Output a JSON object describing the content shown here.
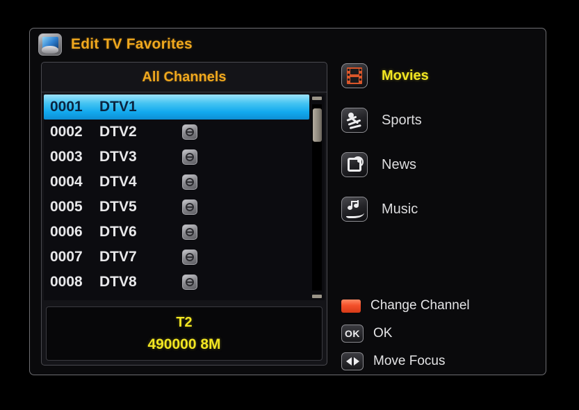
{
  "window": {
    "title": "Edit TV Favorites",
    "title_icon": "tv-icon"
  },
  "channel_list": {
    "header": "All Channels",
    "columns": [
      "number",
      "name",
      "lock"
    ],
    "rows": [
      {
        "number": "0001",
        "name": "DTV1",
        "locked": false,
        "selected": true
      },
      {
        "number": "0002",
        "name": "DTV2",
        "locked": true,
        "selected": false
      },
      {
        "number": "0003",
        "name": "DTV3",
        "locked": true,
        "selected": false
      },
      {
        "number": "0004",
        "name": "DTV4",
        "locked": true,
        "selected": false
      },
      {
        "number": "0005",
        "name": "DTV5",
        "locked": true,
        "selected": false
      },
      {
        "number": "0006",
        "name": "DTV6",
        "locked": true,
        "selected": false
      },
      {
        "number": "0007",
        "name": "DTV7",
        "locked": true,
        "selected": false
      },
      {
        "number": "0008",
        "name": "DTV8",
        "locked": true,
        "selected": false
      }
    ]
  },
  "signal_info": {
    "transponder": "T2",
    "frequency_bandwidth": "490000  8M"
  },
  "categories": [
    {
      "label": "Movies",
      "icon": "film-icon",
      "active": true
    },
    {
      "label": "Sports",
      "icon": "runner-icon",
      "active": false
    },
    {
      "label": "News",
      "icon": "news-icon",
      "active": false
    },
    {
      "label": "Music",
      "icon": "music-note-icon",
      "active": false
    }
  ],
  "legend": [
    {
      "key": "red-button",
      "label": "Change Channel",
      "glyph": ""
    },
    {
      "key": "ok-button",
      "label": "OK",
      "glyph": "OK"
    },
    {
      "key": "left-right-button",
      "label": "Move Focus",
      "glyph": ""
    }
  ],
  "colors": {
    "accent_gold": "#f0a81e",
    "accent_yellow": "#f2e622",
    "selection_blue": "#12a9ee",
    "red_button": "#f4502a",
    "text_primary": "#e8e8ea",
    "panel_bg": "#141418",
    "window_border": "#6e6e72"
  }
}
